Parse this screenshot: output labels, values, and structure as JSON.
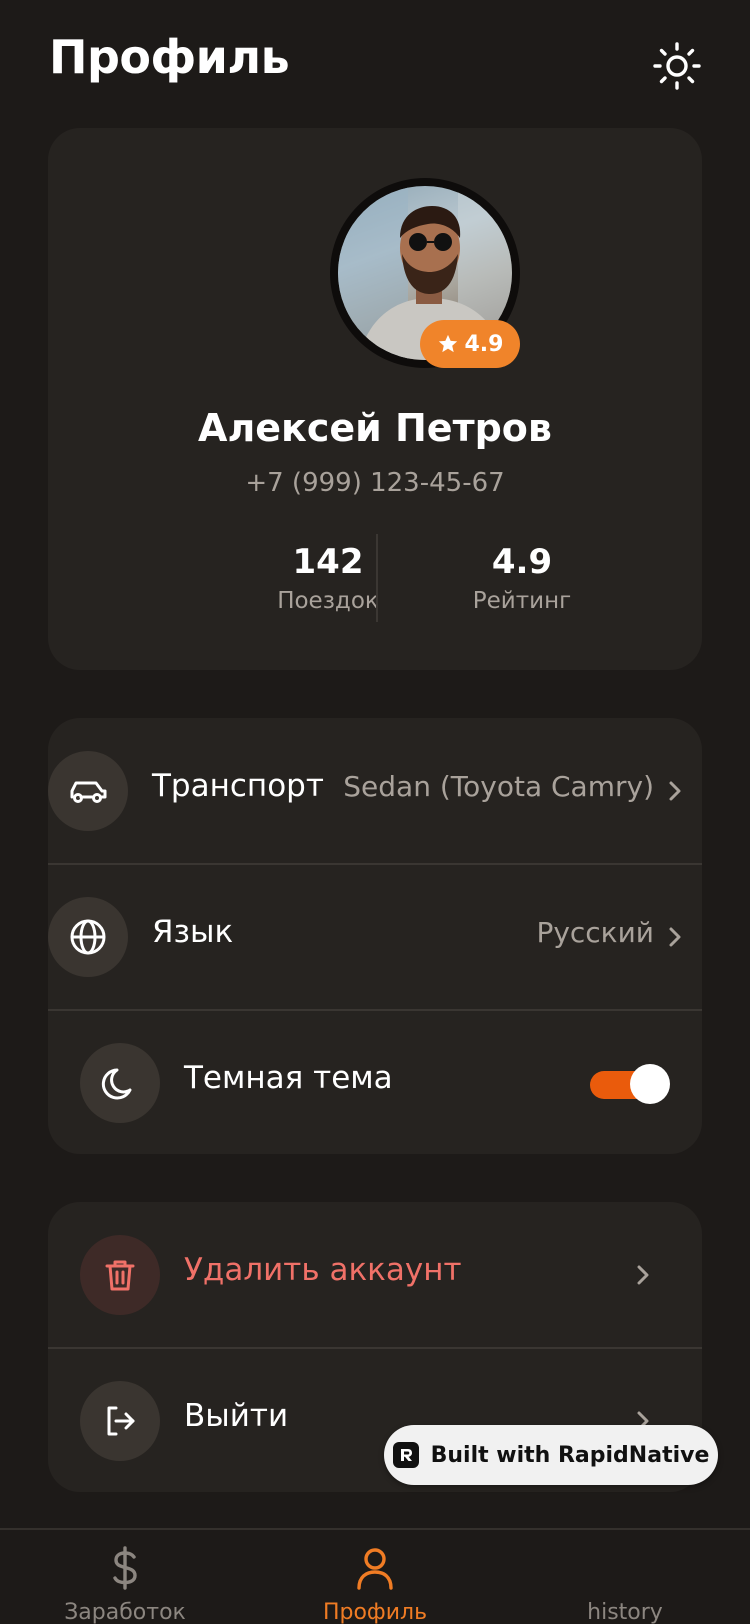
{
  "header": {
    "title": "Профиль",
    "theme_icon": "sun-icon"
  },
  "profile": {
    "avatar": "avatar-photo",
    "rating_badge": "4.9",
    "name": "Алексей Петров",
    "phone": "+7 (999) 123-45-67",
    "stats": [
      {
        "value": "142",
        "label": "Поездок"
      },
      {
        "value": "4.9",
        "label": "Рейтинг"
      }
    ]
  },
  "settings": {
    "vehicle": {
      "label": "Транспорт",
      "value": "Sedan (Toyota Camry)",
      "icon": "car-icon"
    },
    "language": {
      "label": "Язык",
      "value": "Русский",
      "icon": "globe-icon"
    },
    "dark_theme": {
      "label": "Темная тема",
      "icon": "moon-icon",
      "enabled": true
    }
  },
  "account": {
    "delete": {
      "label": "Удалить аккаунт",
      "icon": "trash-icon"
    },
    "logout": {
      "label": "Выйти",
      "icon": "logout-icon"
    }
  },
  "badge": {
    "label": "Built with RapidNative"
  },
  "tabs": [
    {
      "label": "Заработок",
      "icon": "dollar-icon",
      "active": false
    },
    {
      "label": "Профиль",
      "icon": "user-icon",
      "active": true
    },
    {
      "label": "history",
      "icon": "history-icon",
      "active": false
    }
  ],
  "colors": {
    "background": "#1d1a18",
    "card": "#262320",
    "accent": "#f0842a",
    "toggle": "#ea5b0c",
    "danger": "#f07168"
  }
}
